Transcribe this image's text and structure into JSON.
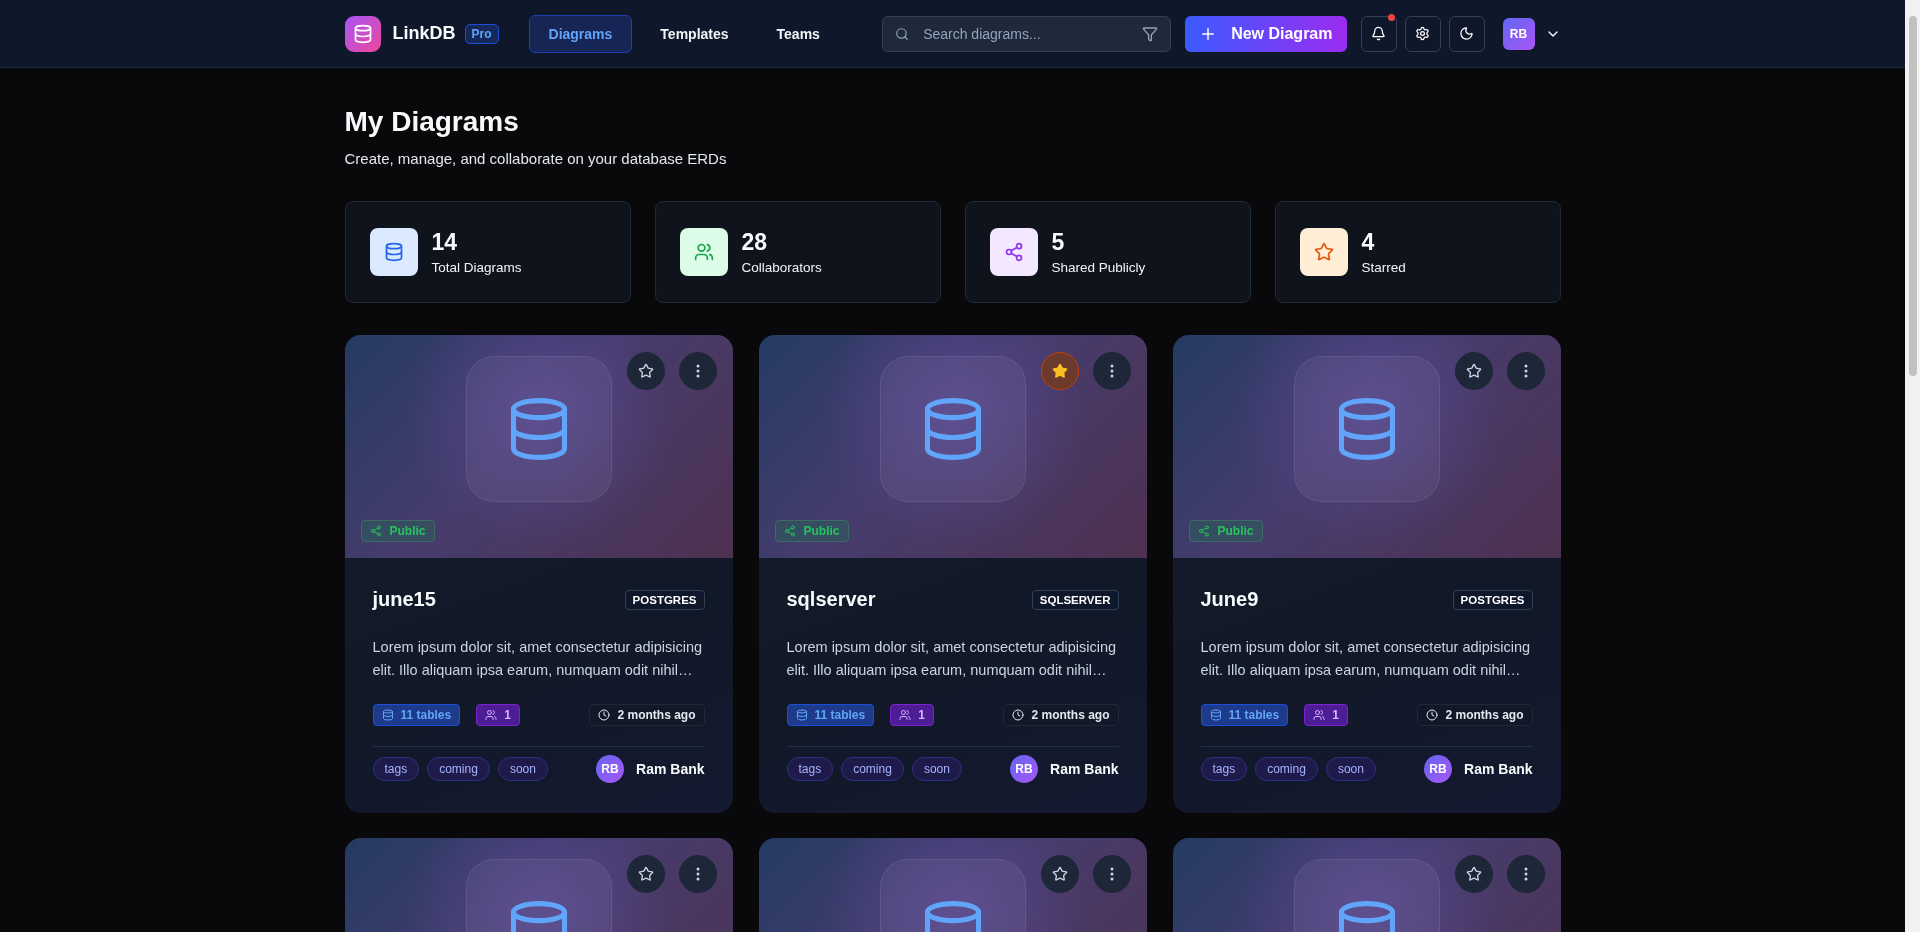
{
  "header": {
    "logo": "LinkDB",
    "plan": "Pro",
    "nav": [
      {
        "label": "Diagrams",
        "selected": true
      },
      {
        "label": "Templates",
        "selected": false
      },
      {
        "label": "Teams",
        "selected": false
      }
    ],
    "search": {
      "placeholder": "Search diagrams..."
    },
    "new_button": "New Diagram",
    "notifications": {
      "unread": true
    },
    "user": {
      "initials": "RB"
    }
  },
  "page": {
    "title": "My Diagrams",
    "subtitle": "Create, manage, and collaborate on your database ERDs"
  },
  "stats": [
    {
      "kind": "diagrams",
      "value": "14",
      "label": "Total Diagrams"
    },
    {
      "kind": "collaborators",
      "value": "28",
      "label": "Collaborators"
    },
    {
      "kind": "shared",
      "value": "5",
      "label": "Shared Publicly"
    },
    {
      "kind": "starred",
      "value": "4",
      "label": "Starred"
    }
  ],
  "diagrams": [
    {
      "title": "june15",
      "database": "POSTGRES",
      "description": "Lorem ipsum dolor sit, amet consectetur adipisicing elit. Illo aliquam ipsa earum, numquam odit nihil…",
      "public": true,
      "public_label": "Public",
      "starred": false,
      "tables": "11 tables",
      "collaborators": "1",
      "updated": "2 months ago",
      "tags": [
        "tags",
        "coming",
        "soon"
      ],
      "owner": {
        "initials": "RB",
        "name": "Ram Bank"
      }
    },
    {
      "title": "sqlserver",
      "database": "SQLSERVER",
      "description": "Lorem ipsum dolor sit, amet consectetur adipisicing elit. Illo aliquam ipsa earum, numquam odit nihil…",
      "public": true,
      "public_label": "Public",
      "starred": true,
      "tables": "11 tables",
      "collaborators": "1",
      "updated": "2 months ago",
      "tags": [
        "tags",
        "coming",
        "soon"
      ],
      "owner": {
        "initials": "RB",
        "name": "Ram Bank"
      }
    },
    {
      "title": "June9",
      "database": "POSTGRES",
      "description": "Lorem ipsum dolor sit, amet consectetur adipisicing elit. Illo aliquam ipsa earum, numquam odit nihil…",
      "public": true,
      "public_label": "Public",
      "starred": false,
      "tables": "11 tables",
      "collaborators": "1",
      "updated": "2 months ago",
      "tags": [
        "tags",
        "coming",
        "soon"
      ],
      "owner": {
        "initials": "RB",
        "name": "Ram Bank"
      }
    },
    {
      "starred": false
    },
    {
      "starred": false
    },
    {
      "starred": false
    }
  ]
}
